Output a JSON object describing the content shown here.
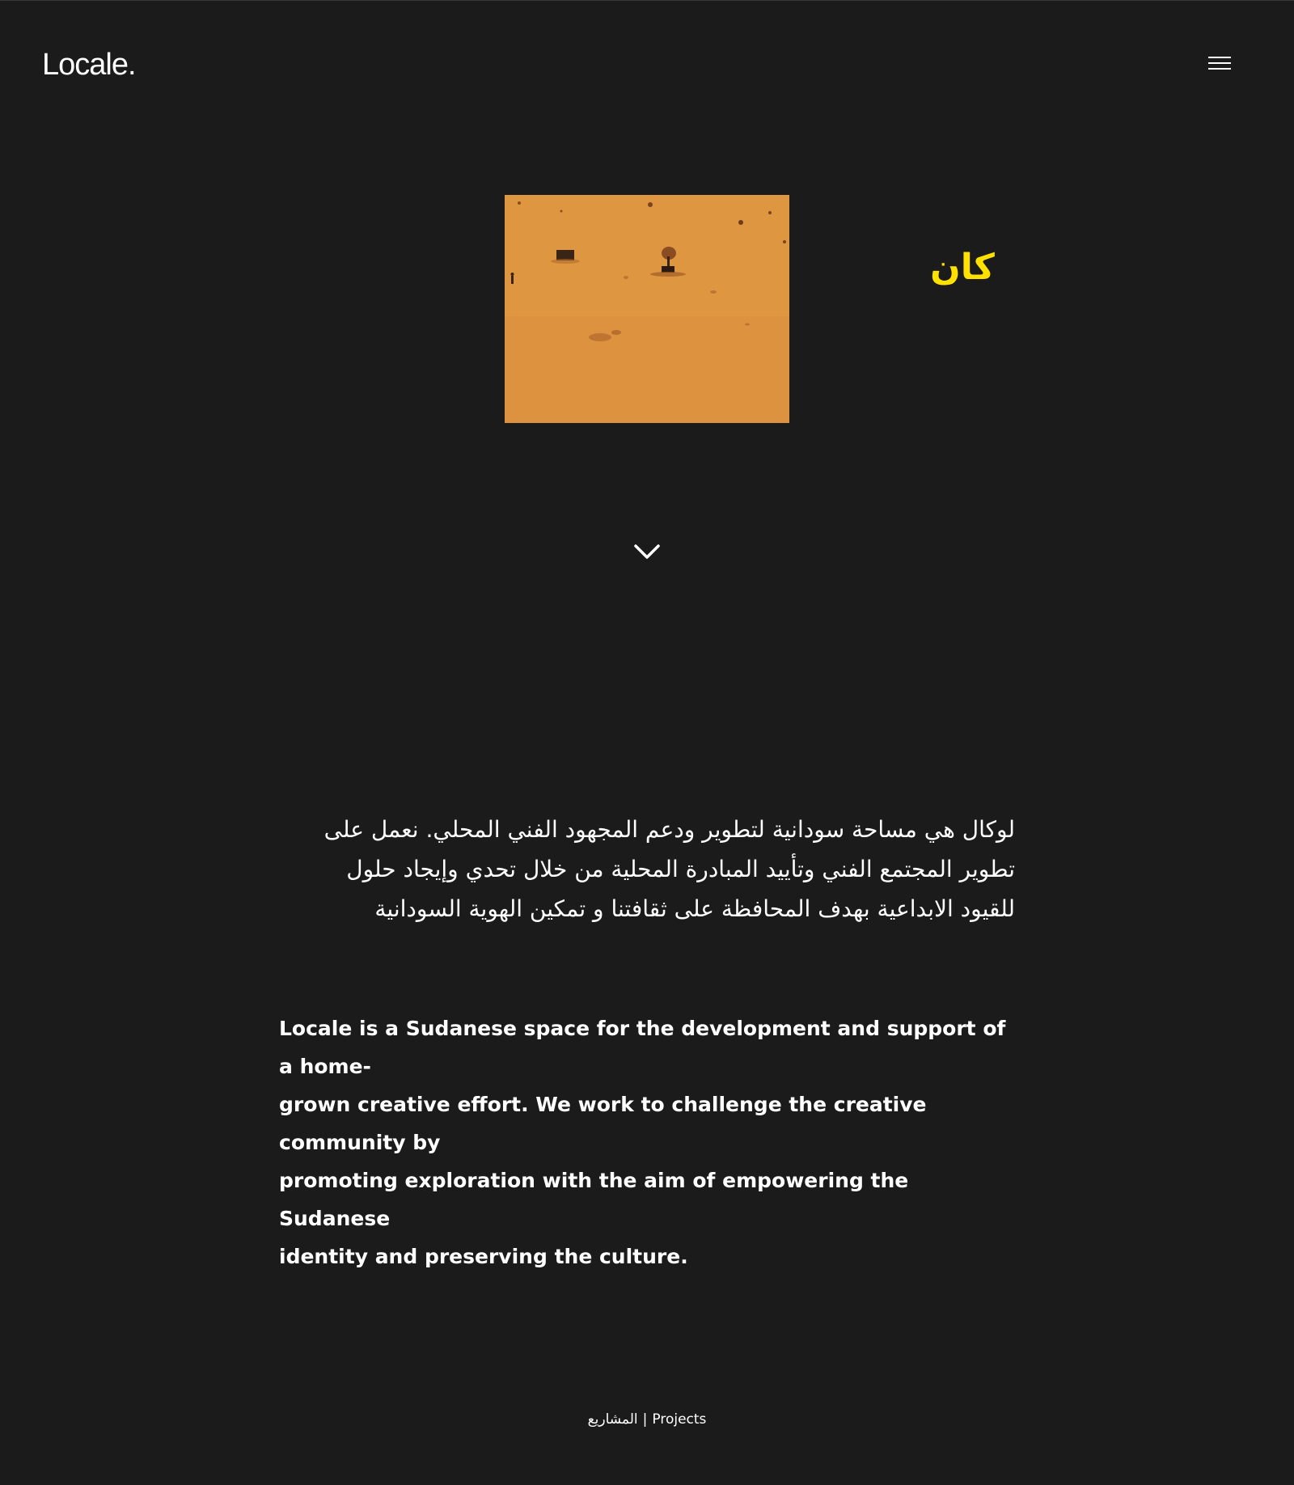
{
  "header": {
    "logo_text": "Locale.",
    "menu_icon": "hamburger-menu-icon"
  },
  "hero": {
    "image_description_icon": "desert-photo",
    "arabic_word": "كان",
    "accent_color": "#ffe100",
    "scroll_icon": "chevron-down-icon"
  },
  "intro": {
    "arabic_lines": [
      "لوكال هي مساحة سودانية لتطوير ودعم المجهود الفني المحلي. نعمل على",
      "تطوير المجتمع الفني وتأييد المبادرة المحلية من خلال تحدي وإيجاد حلول",
      "للقيود الابداعية بهدف المحافظة على ثقافتنا و تمكين الهوية السودانية"
    ],
    "english_lines": [
      "Locale is a Sudanese space for the development and support of a home-",
      "grown creative effort. We work to challenge the creative community by",
      "promoting exploration with the aim of empowering the Sudanese",
      "identity and preserving the culture."
    ]
  },
  "footer": {
    "projects_arabic": "المشاريع",
    "separator": "|",
    "projects_english": "Projects"
  }
}
